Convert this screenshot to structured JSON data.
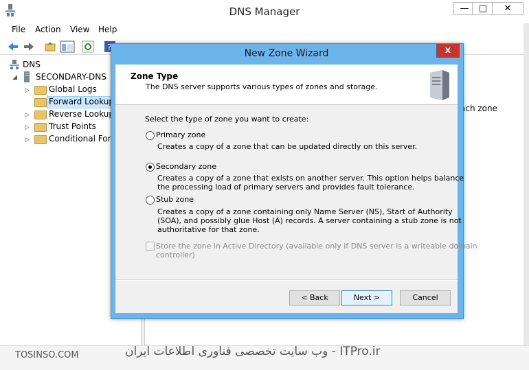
{
  "window": {
    "title": "DNS Manager",
    "minimize": "—",
    "maximize": "□",
    "close": "✕"
  },
  "menu": [
    "File",
    "Action",
    "View",
    "Help"
  ],
  "tree": {
    "root": "DNS",
    "server": "SECONDARY-DNS",
    "items": [
      "Global Logs",
      "Forward Lookup Z",
      "Reverse Lookup Z",
      "Trust Points",
      "Conditional Forw"
    ]
  },
  "right_pane_fragment": "ach zone",
  "dialog": {
    "title": "New Zone Wizard",
    "close": "x",
    "header_title": "Zone Type",
    "header_subtitle": "The DNS server supports various types of zones and storage.",
    "prompt": "Select the type of zone you want to create:",
    "options": [
      {
        "label": "Primary zone",
        "desc": [
          "Creates a copy of a zone that can be updated directly on this server."
        ],
        "selected": false
      },
      {
        "label": "Secondary zone",
        "desc": [
          "Creates a copy of a zone that exists on another server. This option helps balance",
          "the processing load of primary servers and provides fault tolerance."
        ],
        "selected": true
      },
      {
        "label": "Stub zone",
        "desc": [
          "Creates a copy of a zone containing only Name Server (NS), Start of Authority",
          "(SOA), and possibly glue Host (A) records. A server containing a stub zone is not",
          "authoritative for that zone."
        ],
        "selected": false
      }
    ],
    "ad_checkbox": {
      "line1": "Store the zone in Active Directory (available only if DNS server is a writeable domain",
      "line2": "controller)",
      "checked": false,
      "enabled": false
    },
    "buttons": {
      "back": "< Back",
      "next": "Next >",
      "cancel": "Cancel"
    }
  },
  "watermark": {
    "left": "TOSINSO.COM",
    "right": "وب سایت تخصصی فناوری اطلاعات ایران - ITPro.ir"
  },
  "colors": {
    "dialog_frame": "#6cb4ec",
    "close_red": "#c8342b",
    "folder": "#e9c46a"
  }
}
